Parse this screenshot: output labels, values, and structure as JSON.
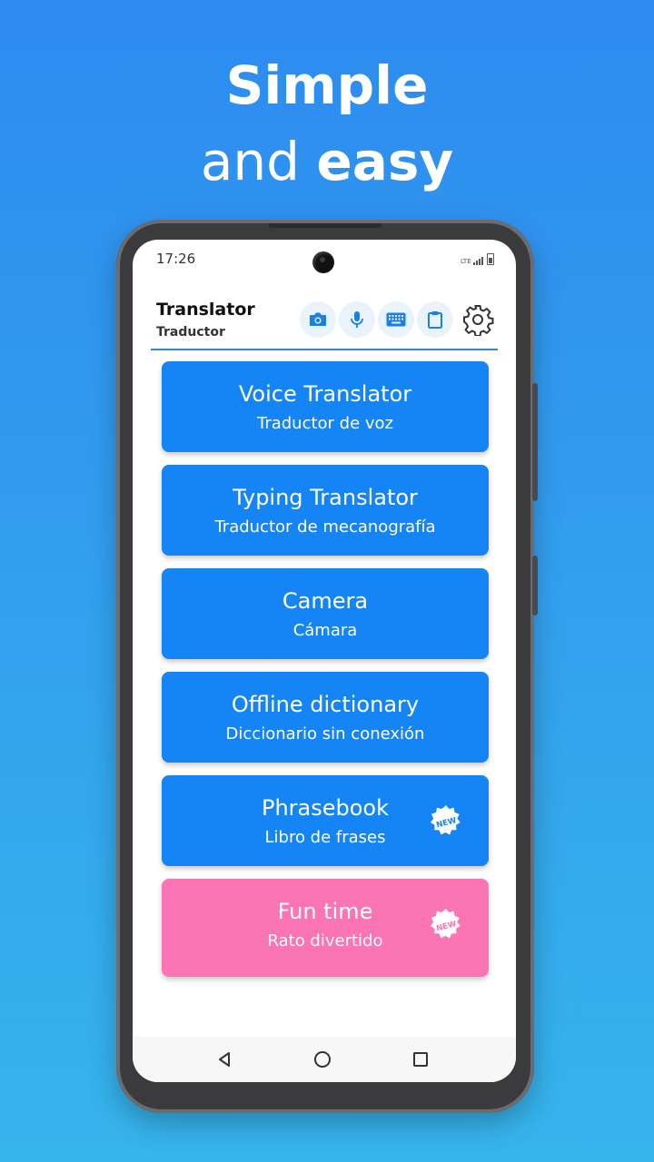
{
  "headline": {
    "line1": "Simple",
    "line2_regular": "and",
    "line2_bold": "easy"
  },
  "status_bar": {
    "time": "17:26",
    "network": "LTE"
  },
  "header": {
    "title": "Translator",
    "subtitle": "Traductor",
    "actions": [
      {
        "icon": "camera-icon"
      },
      {
        "icon": "microphone-icon"
      },
      {
        "icon": "keyboard-icon"
      },
      {
        "icon": "clipboard-icon"
      }
    ],
    "settings_icon": "gear-icon"
  },
  "menu": [
    {
      "title": "Voice Translator",
      "subtitle": "Traductor de voz",
      "color": "#1584f4",
      "new": false
    },
    {
      "title": "Typing Translator",
      "subtitle": "Traductor de mecanografía",
      "color": "#1584f4",
      "new": false
    },
    {
      "title": "Camera",
      "subtitle": "Cámara",
      "color": "#1584f4",
      "new": false
    },
    {
      "title": "Offline dictionary",
      "subtitle": "Diccionario sin conexión",
      "color": "#1584f4",
      "new": false
    },
    {
      "title": "Phrasebook",
      "subtitle": "Libro de frases",
      "color": "#1584f4",
      "new": true,
      "badge": "NEW"
    },
    {
      "title": "Fun time",
      "subtitle": "Rato divertido",
      "color": "#fb74b3",
      "new": true,
      "badge": "NEW"
    }
  ],
  "colors": {
    "accent": "#1584f4",
    "pink": "#fb74b3",
    "background_top": "#2e8bf0",
    "background_bottom": "#36b4ec"
  },
  "navbar": {
    "items": [
      "back-icon",
      "home-icon",
      "recents-icon"
    ]
  }
}
